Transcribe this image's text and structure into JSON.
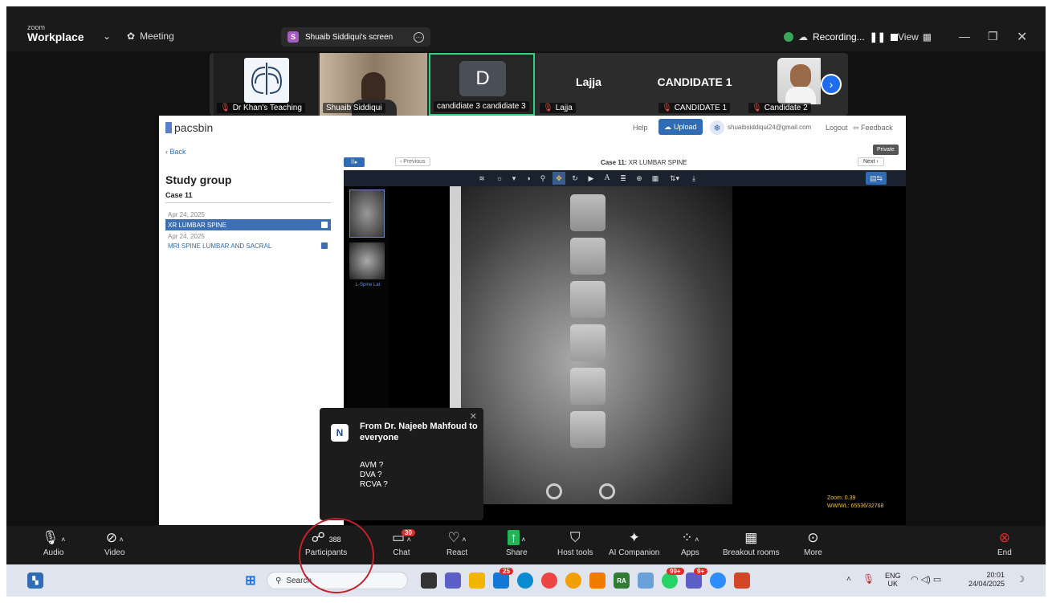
{
  "topbar": {
    "brand_small": "zoom",
    "brand_big": "Workplace",
    "meeting_label": "Meeting",
    "share_initial": "S",
    "share_label": "Shuaib Siddiqui's screen",
    "recording_label": "Recording...",
    "view_label": "View"
  },
  "participants_strip": [
    {
      "name": "Dr Khan's Teaching",
      "muted": true
    },
    {
      "name": "Shuaib Siddiqui",
      "muted": false
    },
    {
      "name": "candidiate 3 candidiate 3",
      "muted": false,
      "initial": "D"
    },
    {
      "name": "Lajja",
      "muted": true,
      "display": "Lajja"
    },
    {
      "name": "CANDIDATE 1",
      "muted": true,
      "display": "CANDIDATE 1"
    },
    {
      "name": "Candidate 2",
      "muted": true
    }
  ],
  "pacs": {
    "logo": "pacsbin",
    "nav": {
      "help": "Help",
      "upload": "Upload",
      "email": "shuaibsiddiqui24@gmail.com",
      "logout": "Logout",
      "feedback": "Feedback"
    },
    "back": "Back",
    "private": "Private",
    "group_title": "Study group",
    "case": "Case 11",
    "studies": [
      {
        "date": "Apr 24, 2025",
        "name": "XR LUMBAR SPINE",
        "selected": true
      },
      {
        "date": "Apr 24, 2025",
        "name": "MRI SPINE LUMBAR AND SACRAL",
        "selected": false
      }
    ],
    "viewer": {
      "previous": "Previous",
      "case_prefix": "Case 11:",
      "case_title": "XR LUMBAR SPINE",
      "next": "Next",
      "thumb_label": "L-Spine Lat",
      "zoom": "Zoom: 0.39",
      "wwwl": "WW/WL: 65536/32768"
    }
  },
  "chat_popup": {
    "from": "From Dr. Najeeb Mahfoud to everyone",
    "lines": [
      "AVM ?",
      "DVA ?",
      "RCVA ?"
    ]
  },
  "bottombar": {
    "audio": "Audio",
    "video": "Video",
    "participants": "Participants",
    "participants_count": "388",
    "chat": "Chat",
    "chat_badge": "30",
    "react": "React",
    "share": "Share",
    "host_tools": "Host tools",
    "ai_companion": "AI Companion",
    "apps": "Apps",
    "breakout": "Breakout rooms",
    "more": "More",
    "end": "End"
  },
  "taskbar": {
    "search_placeholder": "Search",
    "badge_25": "25",
    "badge_99": "99+",
    "badge_9": "9+",
    "lang1": "ENG",
    "lang2": "UK",
    "time": "20:01",
    "date": "24/04/2025"
  }
}
